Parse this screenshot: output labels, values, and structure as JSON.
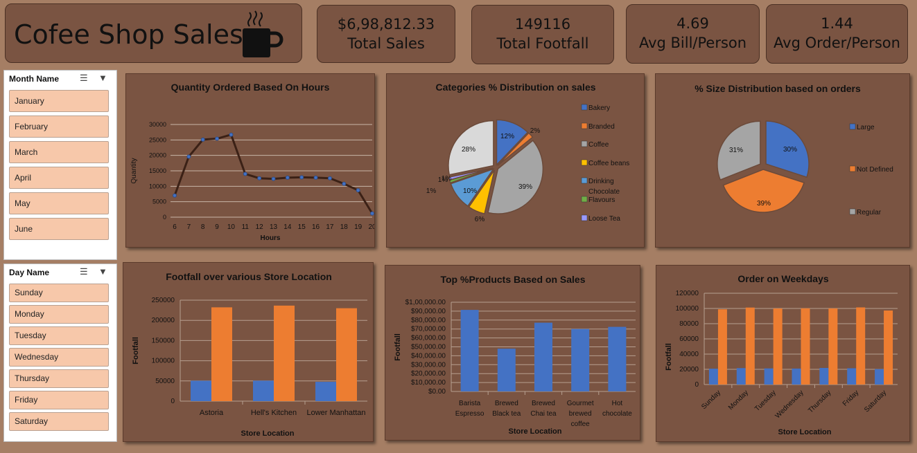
{
  "header": {
    "title": "Cofee Shop Sales",
    "icon": "coffee-mug-icon"
  },
  "kpis": [
    {
      "value": "$6,98,812.33",
      "label": "Total Sales"
    },
    {
      "value": "149116",
      "label": "Total Footfall"
    },
    {
      "value": "4.69",
      "label": "Avg Bill/Person"
    },
    {
      "value": "1.44",
      "label": "Avg Order/Person"
    }
  ],
  "slicers": {
    "month": {
      "header": "Month Name",
      "items": [
        "January",
        "February",
        "March",
        "April",
        "May",
        "June"
      ]
    },
    "day": {
      "header": "Day Name",
      "items": [
        "Sunday",
        "Monday",
        "Tuesday",
        "Wednesday",
        "Thursday",
        "Friday",
        "Saturday"
      ]
    }
  },
  "colors": {
    "blue": "#4472c4",
    "orange": "#ed7d31",
    "gray": "#a5a5a5",
    "gold": "#ffc000",
    "lightblue": "#5b9bd5",
    "green": "#70ad47",
    "lavender": "#9999ff"
  },
  "chart_data": [
    {
      "type": "line",
      "title": "Quantity Ordered Based On  Hours",
      "xlabel": "Hours",
      "ylabel": "Quantity",
      "x": [
        6,
        7,
        8,
        9,
        10,
        11,
        12,
        13,
        14,
        15,
        16,
        17,
        18,
        19,
        20
      ],
      "values": [
        7000,
        19600,
        25100,
        25400,
        26700,
        14000,
        12600,
        12400,
        12800,
        12900,
        12800,
        12600,
        10800,
        8700,
        1200
      ],
      "ylim": [
        0,
        30000
      ],
      "yticks": [
        0,
        5000,
        10000,
        15000,
        20000,
        25000,
        30000
      ]
    },
    {
      "type": "pie",
      "title": "Categories % Distribution on sales",
      "categories": [
        "Bakery",
        "Branded",
        "Coffee",
        "Coffee beans",
        "Drinking Chocolate",
        "Flavours",
        "Loose Tea",
        "Tea"
      ],
      "values": [
        12,
        2,
        39,
        6,
        10,
        1,
        1,
        28
      ],
      "legend": [
        "Bakery",
        "Branded",
        "Coffee",
        "Coffee beans",
        "Drinking Chocolate",
        "Flavours",
        "Loose Tea"
      ],
      "labels": [
        "12%",
        "2%",
        "39%",
        "6%",
        "10%",
        "1%",
        "1%",
        "28%",
        "1%"
      ]
    },
    {
      "type": "pie",
      "title": "% Size Distribution based on orders",
      "categories": [
        "Large",
        "Not Defined",
        "Regular"
      ],
      "values": [
        30,
        39,
        31
      ],
      "labels": [
        "30%",
        "39%",
        "31%"
      ]
    },
    {
      "type": "bar",
      "title": "Footfall over various Store Location",
      "xlabel": "Store Location",
      "ylabel": "Footfall",
      "categories": [
        "Astoria",
        "Hell's Kitchen",
        "Lower Manhattan"
      ],
      "series": [
        {
          "values": [
            50599,
            50735,
            47782
          ]
        },
        {
          "values": [
            232244,
            236511,
            230058
          ]
        }
      ],
      "ylim": [
        0,
        250000
      ],
      "yticks": [
        "0",
        "50000",
        "100000",
        "150000",
        "200000",
        "250000"
      ]
    },
    {
      "type": "bar",
      "title": "Top %Products Based on Sales",
      "xlabel": "Store Location",
      "ylabel": "Footfall",
      "categories": [
        [
          "Barista",
          "Espresso"
        ],
        [
          "Brewed",
          "Black tea"
        ],
        [
          "Brewed",
          "Chai tea"
        ],
        [
          "Gourmet",
          "brewed",
          "coffee"
        ],
        [
          "Hot",
          "chocolate"
        ]
      ],
      "values": [
        91406,
        47932,
        77082,
        70034,
        72416
      ],
      "ylim": [
        0,
        100000
      ],
      "yticks": [
        "$0.00",
        "$10,000.00",
        "$20,000.00",
        "$30,000.00",
        "$40,000.00",
        "$50,000.00",
        "$60,000.00",
        "$70,000.00",
        "$80,000.00",
        "$90,000.00",
        "$1,00,000.00"
      ]
    },
    {
      "type": "bar",
      "title": "Order on Weekdays",
      "xlabel": "Store Location",
      "ylabel": "Footfall",
      "categories": [
        "Sunday",
        "Monday",
        "Tuesday",
        "Wednesday",
        "Thursday",
        "Friday",
        "Saturday"
      ],
      "series": [
        {
          "values": [
            20800,
            21600,
            21200,
            21000,
            21800,
            21400,
            20300
          ]
        },
        {
          "values": [
            98900,
            101200,
            100000,
            100200,
            100100,
            101400,
            97300
          ]
        }
      ],
      "ylim": [
        0,
        120000
      ],
      "yticks": [
        "0",
        "20000",
        "40000",
        "60000",
        "80000",
        "100000",
        "120000"
      ]
    }
  ]
}
